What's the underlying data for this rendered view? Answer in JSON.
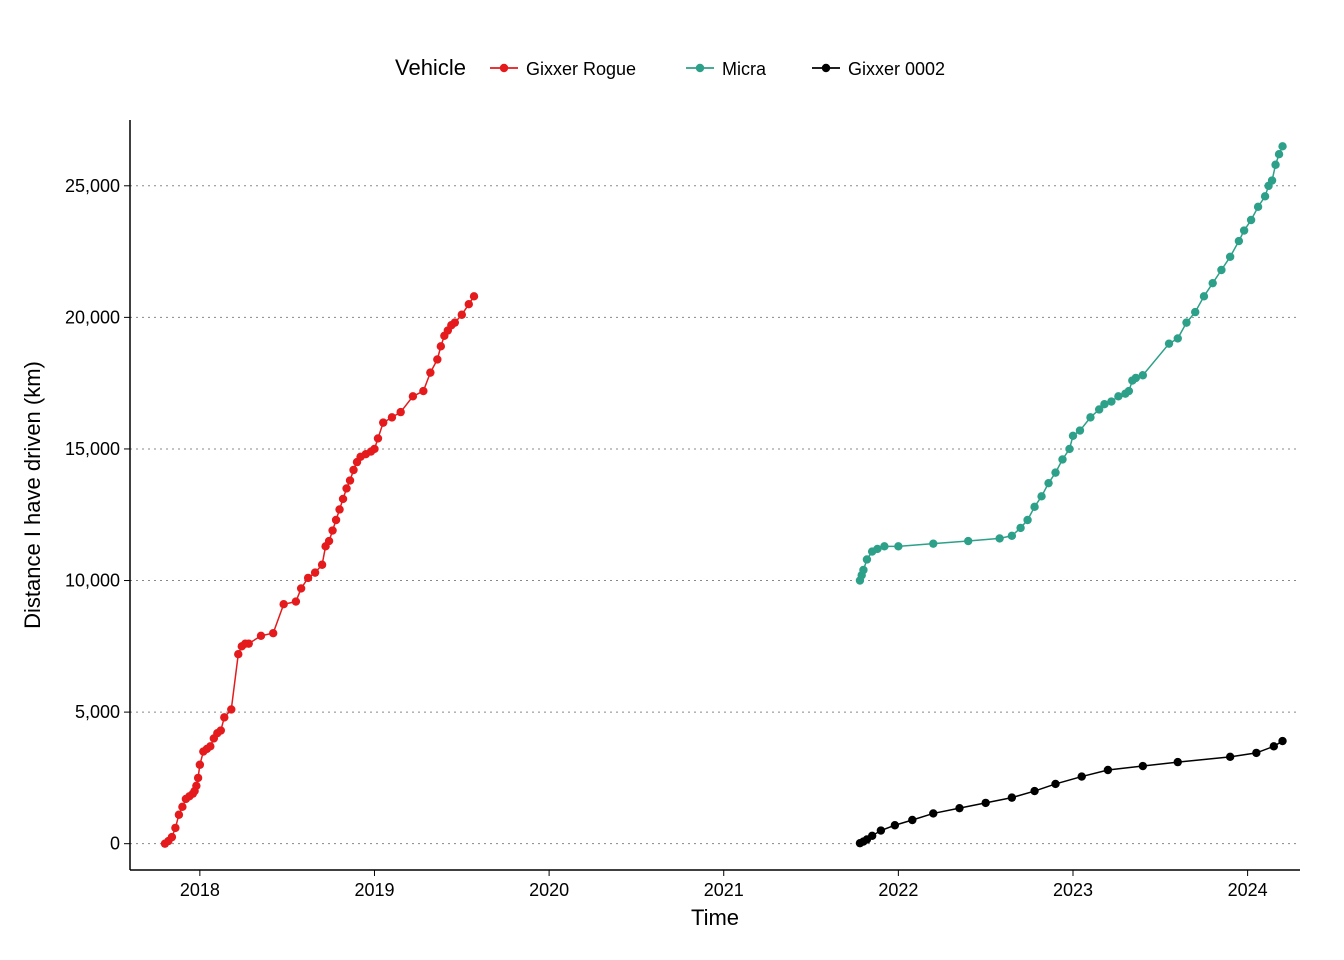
{
  "chart_data": {
    "type": "line",
    "title": "",
    "xlabel": "Time",
    "ylabel": "Distance I have driven (km)",
    "legend_title": "Vehicle",
    "legend_position": "top",
    "xlim": [
      2017.6,
      2024.3
    ],
    "ylim": [
      -1000,
      27500
    ],
    "x_ticks": [
      2018,
      2019,
      2020,
      2021,
      2022,
      2023,
      2024
    ],
    "y_ticks": [
      0,
      5000,
      10000,
      15000,
      20000,
      25000
    ],
    "y_tick_labels": [
      "0",
      "5,000",
      "10,000",
      "15,000",
      "20,000",
      "25,000"
    ],
    "series": [
      {
        "name": "Gixxer Rogue",
        "color": "#E41A1C",
        "x": [
          2017.8,
          2017.82,
          2017.84,
          2017.86,
          2017.88,
          2017.9,
          2017.92,
          2017.94,
          2017.96,
          2017.97,
          2017.98,
          2017.99,
          2018.0,
          2018.02,
          2018.04,
          2018.06,
          2018.08,
          2018.1,
          2018.12,
          2018.14,
          2018.18,
          2018.22,
          2018.24,
          2018.26,
          2018.28,
          2018.35,
          2018.42,
          2018.48,
          2018.55,
          2018.58,
          2018.62,
          2018.66,
          2018.7,
          2018.72,
          2018.74,
          2018.76,
          2018.78,
          2018.8,
          2018.82,
          2018.84,
          2018.86,
          2018.88,
          2018.9,
          2018.92,
          2018.95,
          2018.98,
          2019.0,
          2019.02,
          2019.05,
          2019.1,
          2019.15,
          2019.22,
          2019.28,
          2019.32,
          2019.36,
          2019.38,
          2019.4,
          2019.42,
          2019.44,
          2019.46,
          2019.5,
          2019.54,
          2019.57
        ],
        "y": [
          0,
          100,
          250,
          600,
          1100,
          1400,
          1700,
          1800,
          1900,
          2000,
          2200,
          2500,
          3000,
          3500,
          3600,
          3700,
          4000,
          4200,
          4300,
          4800,
          5100,
          7200,
          7500,
          7600,
          7600,
          7900,
          8000,
          9100,
          9200,
          9700,
          10100,
          10300,
          10600,
          11300,
          11500,
          11900,
          12300,
          12700,
          13100,
          13500,
          13800,
          14200,
          14500,
          14700,
          14800,
          14900,
          15000,
          15400,
          16000,
          16200,
          16400,
          17000,
          17200,
          17900,
          18400,
          18900,
          19300,
          19500,
          19700,
          19800,
          20100,
          20500,
          20800
        ]
      },
      {
        "name": "Micra",
        "color": "#2CA089",
        "x": [
          2021.78,
          2021.79,
          2021.8,
          2021.82,
          2021.85,
          2021.88,
          2021.92,
          2022.0,
          2022.2,
          2022.4,
          2022.58,
          2022.65,
          2022.7,
          2022.74,
          2022.78,
          2022.82,
          2022.86,
          2022.9,
          2022.94,
          2022.98,
          2023.0,
          2023.04,
          2023.1,
          2023.15,
          2023.18,
          2023.22,
          2023.26,
          2023.3,
          2023.32,
          2023.34,
          2023.36,
          2023.4,
          2023.55,
          2023.6,
          2023.65,
          2023.7,
          2023.75,
          2023.8,
          2023.85,
          2023.9,
          2023.95,
          2023.98,
          2024.02,
          2024.06,
          2024.1,
          2024.12,
          2024.14,
          2024.16,
          2024.18,
          2024.2
        ],
        "y": [
          10000,
          10200,
          10400,
          10800,
          11100,
          11200,
          11300,
          11300,
          11400,
          11500,
          11600,
          11700,
          12000,
          12300,
          12800,
          13200,
          13700,
          14100,
          14600,
          15000,
          15500,
          15700,
          16200,
          16500,
          16700,
          16800,
          17000,
          17100,
          17200,
          17600,
          17700,
          17800,
          19000,
          19200,
          19800,
          20200,
          20800,
          21300,
          21800,
          22300,
          22900,
          23300,
          23700,
          24200,
          24600,
          25000,
          25200,
          25800,
          26200,
          26500
        ]
      },
      {
        "name": "Gixxer 0002",
        "color": "#000000",
        "x": [
          2021.78,
          2021.8,
          2021.82,
          2021.85,
          2021.9,
          2021.98,
          2022.08,
          2022.2,
          2022.35,
          2022.5,
          2022.65,
          2022.78,
          2022.9,
          2023.05,
          2023.2,
          2023.4,
          2023.6,
          2023.9,
          2024.05,
          2024.15,
          2024.2
        ],
        "y": [
          20,
          80,
          160,
          300,
          500,
          700,
          900,
          1150,
          1350,
          1550,
          1750,
          2000,
          2270,
          2550,
          2800,
          2950,
          3100,
          3300,
          3450,
          3700,
          3900
        ]
      }
    ]
  }
}
